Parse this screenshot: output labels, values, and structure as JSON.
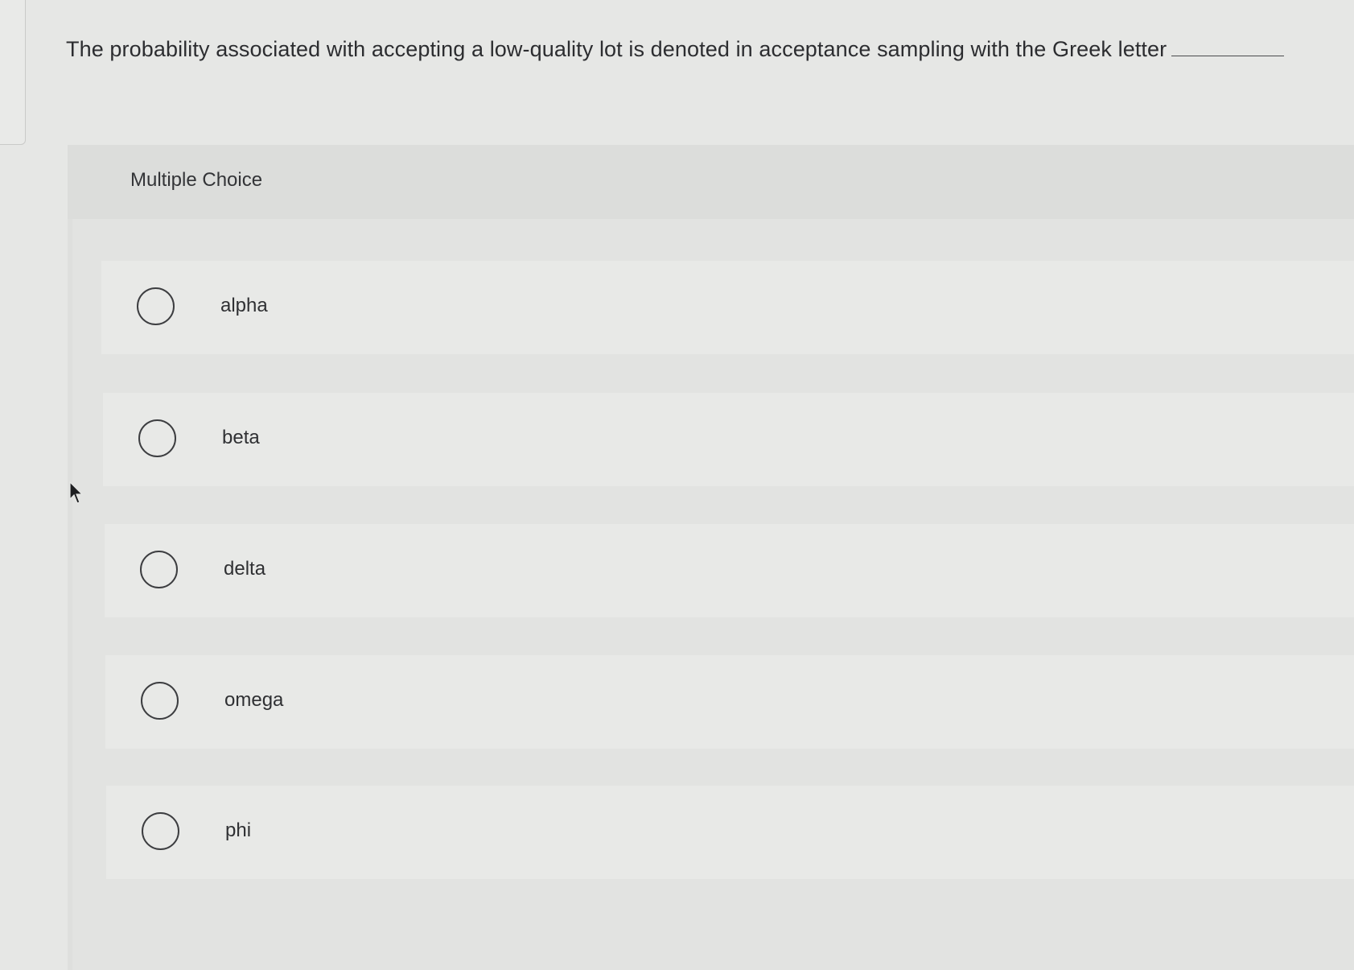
{
  "question": {
    "text": "The probability associated with accepting a low-quality lot is denoted in acceptance sampling with the Greek letter"
  },
  "multiple_choice": {
    "header_label": "Multiple Choice",
    "options": [
      {
        "label": "alpha",
        "selected": false
      },
      {
        "label": "beta",
        "selected": false
      },
      {
        "label": "delta",
        "selected": false
      },
      {
        "label": "omega",
        "selected": false
      },
      {
        "label": "phi",
        "selected": false
      }
    ]
  },
  "icons": {
    "radio": "radio-unchecked-icon",
    "cursor": "mouse-pointer-icon"
  },
  "colors": {
    "background": "#e6e7e5",
    "panel": "#dedfdd",
    "option_background": "#e8e9e7",
    "text": "#2f3032"
  }
}
